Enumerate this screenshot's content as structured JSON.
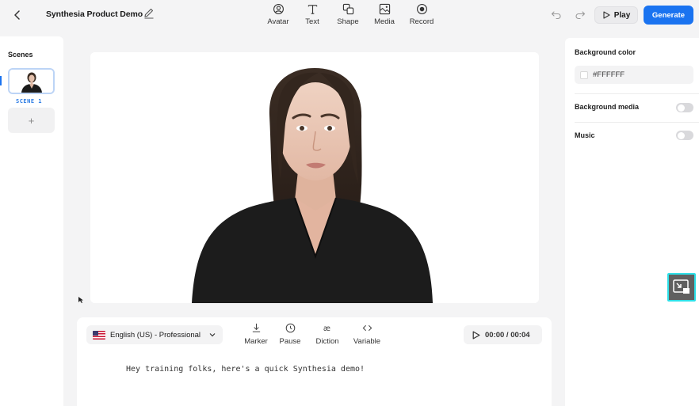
{
  "header": {
    "title": "Synthesia Product Demo",
    "tools": [
      {
        "label": "Avatar",
        "icon": "avatar-icon"
      },
      {
        "label": "Text",
        "icon": "text-icon"
      },
      {
        "label": "Shape",
        "icon": "shape-icon"
      },
      {
        "label": "Media",
        "icon": "media-icon"
      },
      {
        "label": "Record",
        "icon": "record-icon"
      }
    ],
    "play_label": "Play",
    "generate_label": "Generate"
  },
  "scenes": {
    "title": "Scenes",
    "items": [
      {
        "label": "SCENE 1"
      }
    ],
    "add_label": "+"
  },
  "script": {
    "language": "English (US) - Professional",
    "tools": [
      {
        "label": "Marker",
        "icon": "marker-icon"
      },
      {
        "label": "Pause",
        "icon": "clock-icon"
      },
      {
        "label": "Diction",
        "icon": "diction-icon"
      },
      {
        "label": "Variable",
        "icon": "code-brackets-icon"
      }
    ],
    "timer": "00:00 / 00:04",
    "text": "Hey training folks, here's a quick Synthesia demo!"
  },
  "properties": {
    "bg_color_label": "Background color",
    "bg_color_value": "#FFFFFF",
    "bg_media_label": "Background media",
    "bg_media_enabled": false,
    "music_label": "Music",
    "music_enabled": false
  },
  "colors": {
    "accent": "#1a73f0",
    "scene_label": "#2a7be4",
    "pip_border": "#2ee0e8"
  }
}
